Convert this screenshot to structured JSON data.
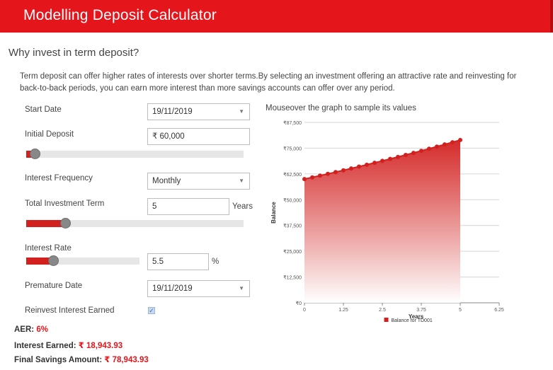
{
  "header": {
    "title": "Modelling Deposit Calculator"
  },
  "section": {
    "title": "Why invest in term deposit?",
    "description": "Term deposit can offer higher rates of interests over shorter terms.By selecting an investment offering an attractive rate and reinvesting for back-to-back periods, you can earn more interest than more savings accounts can offer over any period."
  },
  "form": {
    "start_date": {
      "label": "Start Date",
      "value": "19/11/2019"
    },
    "initial_deposit": {
      "label": "Initial Deposit",
      "value": "₹ 60,000",
      "slider_level": 0.04
    },
    "interest_frequency": {
      "label": "Interest Frequency",
      "value": "Monthly"
    },
    "investment_term": {
      "label": "Total Investment Term",
      "value": "5",
      "unit": "Years",
      "slider_level": 0.18
    },
    "interest_rate": {
      "label": "Interest Rate",
      "value": "5.5",
      "unit": "%",
      "slider_level": 0.24
    },
    "premature_date": {
      "label": "Premature Date",
      "value": "19/11/2019"
    },
    "reinvest": {
      "label": "Reinvest Interest Earned",
      "checked": true
    }
  },
  "summary": {
    "aer_label": "AER:",
    "aer_value": "6%",
    "interest_label": "Interest Earned:",
    "interest_value": "₹ 18,943.93",
    "final_label": "Final Savings Amount:",
    "final_value": "₹ 78,943.93"
  },
  "chart_caption": "Mouseover the graph to sample its values",
  "colors": {
    "brand_red": "#e4151b",
    "series_red": "#d2201f"
  },
  "chart_data": {
    "type": "area",
    "ylabel": "Balance",
    "xlabel": "Years",
    "xlim": [
      0,
      6.25
    ],
    "ylim": [
      0,
      87500
    ],
    "x_ticks": [
      "0",
      "1.25",
      "2.5",
      "3.75",
      "5",
      "6.25"
    ],
    "y_ticks": [
      "₹0",
      "₹12,500",
      "₹25,000",
      "₹37,500",
      "₹50,000",
      "₹62,500",
      "₹75,000",
      "₹87,500"
    ],
    "legend": "bottom-center",
    "series": [
      {
        "name": "Balance for TD001",
        "x": [
          0,
          0.25,
          0.5,
          0.75,
          1,
          1.25,
          1.5,
          1.75,
          2,
          2.25,
          2.5,
          2.75,
          3,
          3.25,
          3.5,
          3.75,
          4,
          4.25,
          4.5,
          4.75,
          5
        ],
        "y": [
          60000,
          60830,
          61670,
          62520,
          63380,
          64260,
          65150,
          66050,
          66960,
          67890,
          68830,
          69780,
          70740,
          71720,
          72710,
          73710,
          74730,
          75760,
          76810,
          77870,
          78944
        ]
      }
    ]
  }
}
